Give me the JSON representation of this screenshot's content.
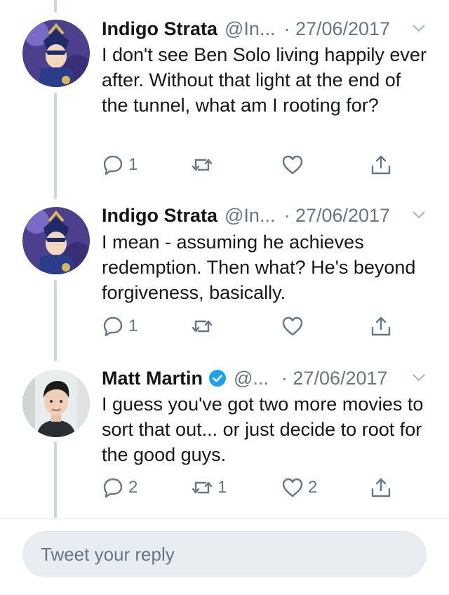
{
  "tweets": [
    {
      "author": "Indigo Strata",
      "handle": "@In...",
      "date": "· 27/06/2017",
      "text": "I don't see Ben Solo living happily ever after. Without that light at the end of the tunnel, what am I rooting for?",
      "replies": "1",
      "retweets": "",
      "likes": "",
      "verified": false
    },
    {
      "author": "Indigo Strata",
      "handle": "@In...",
      "date": "· 27/06/2017",
      "text": "I mean - assuming he achieves redemption. Then what? He's beyond forgiveness, basically.",
      "replies": "1",
      "retweets": "",
      "likes": "",
      "verified": false
    },
    {
      "author": "Matt Martin",
      "handle": "@...",
      "date": "· 27/06/2017",
      "text": "I guess you've got two more movies to sort that out... or just decide to root for the good guys.",
      "replies": "2",
      "retweets": "1",
      "likes": "2",
      "verified": true
    }
  ],
  "reply_box": {
    "placeholder": "Tweet your reply"
  },
  "colors": {
    "text": "#14171a",
    "secondary": "#657786",
    "verified": "#1da1f2",
    "thread": "#ccd6dd",
    "reply_bg": "#e6ecf0"
  }
}
